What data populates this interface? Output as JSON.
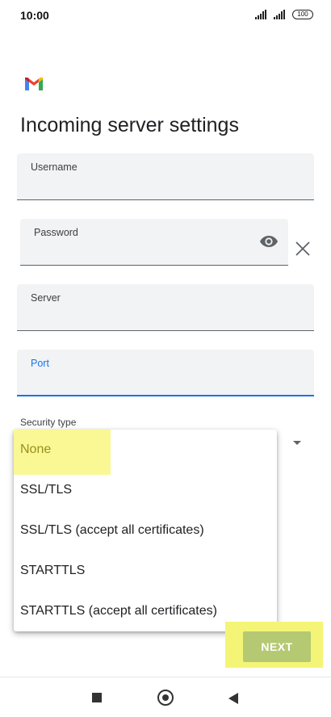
{
  "status_bar": {
    "time": "10:00",
    "battery": "100",
    "icons": [
      "signal-icon",
      "signal-icon",
      "battery-icon"
    ]
  },
  "header": {
    "logo": "gmail-logo",
    "title": "Incoming server settings"
  },
  "form": {
    "username": {
      "label": "Username",
      "value": ""
    },
    "password": {
      "label": "Password",
      "value": "",
      "icon": "eye-icon"
    },
    "server": {
      "label": "Server",
      "value": ""
    },
    "port": {
      "label": "Port",
      "value": ""
    },
    "security": {
      "label": "Security type",
      "selected": "None",
      "options": [
        "None",
        "SSL/TLS",
        "SSL/TLS (accept all certificates)",
        "STARTTLS",
        "STARTTLS (accept all certificates)"
      ]
    }
  },
  "actions": {
    "next_label": "NEXT"
  },
  "nav": {
    "icons": [
      "recents-icon",
      "home-icon",
      "back-icon"
    ]
  },
  "colors": {
    "accent": "#1a73e8",
    "highlight": "#f8f782",
    "next_button": "#b5c973",
    "field_bg": "#f1f3f4"
  }
}
